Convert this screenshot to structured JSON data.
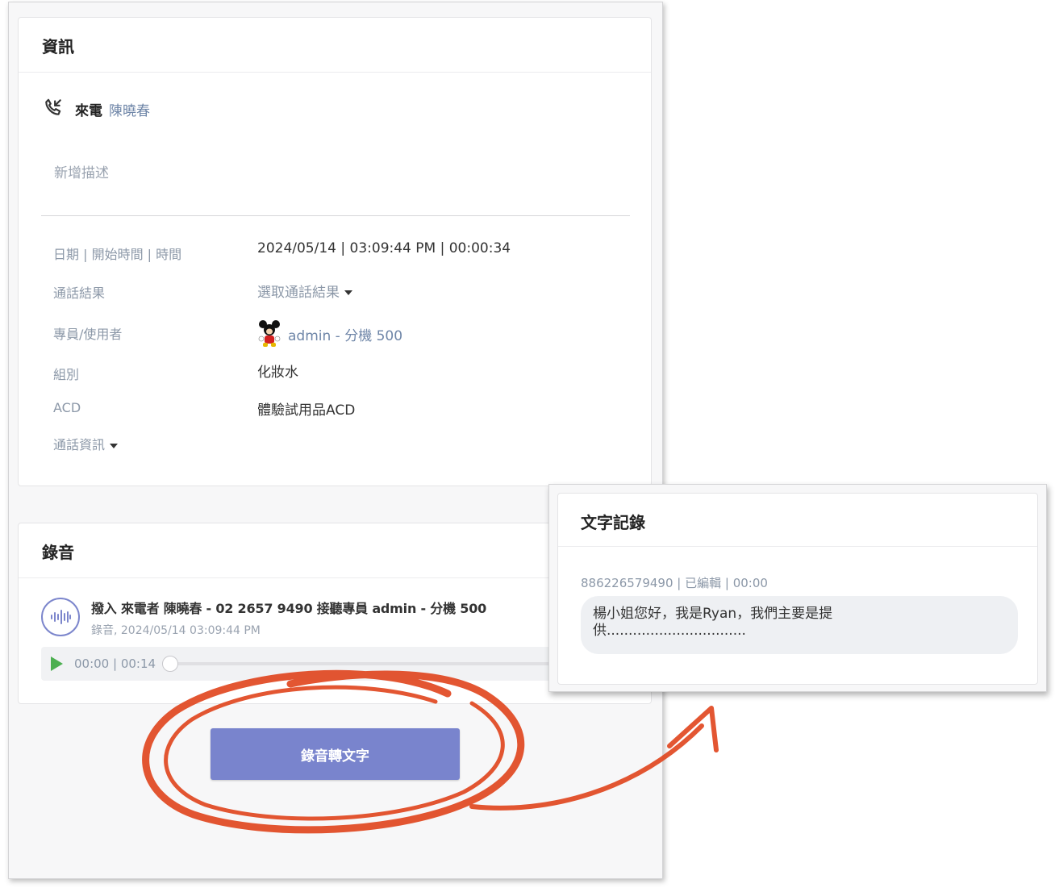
{
  "info": {
    "title": "資訊",
    "call_direction": "來電",
    "caller_name": "陳曉春",
    "add_description": "新增描述",
    "fields": {
      "datetime_label": "日期 | 開始時間 | 時間",
      "datetime_value": "2024/05/14 | 03:09:44 PM | 00:00:34",
      "result_label": "通話結果",
      "result_value": "選取通話結果",
      "agent_label": "專員/使用者",
      "agent_value": "admin - 分機 500",
      "group_label": "組別",
      "group_value": "化妝水",
      "acd_label": "ACD",
      "acd_value": "體驗試用品ACD",
      "call_info_label": "通話資訊"
    }
  },
  "recording": {
    "title": "錄音",
    "description": "撥入 來電者 陳曉春 - 02 2657 9490 接聽專員 admin - 分機 500",
    "meta": "錄音, 2024/05/14 03:09:44 PM",
    "time": "00:00 | 00:14",
    "progress": 0,
    "convert_button": "錄音轉文字"
  },
  "transcript": {
    "title": "文字記錄",
    "entry_meta": "886226579490 | 已編輯 | 00:00",
    "entry_line1": "楊小姐您好，我是Ryan，我們主要是提",
    "entry_line2": "供................................"
  },
  "colors": {
    "accent": "#7984cd",
    "play": "#4caf50",
    "annotation": "#e0441c",
    "link": "#6f86a8"
  }
}
